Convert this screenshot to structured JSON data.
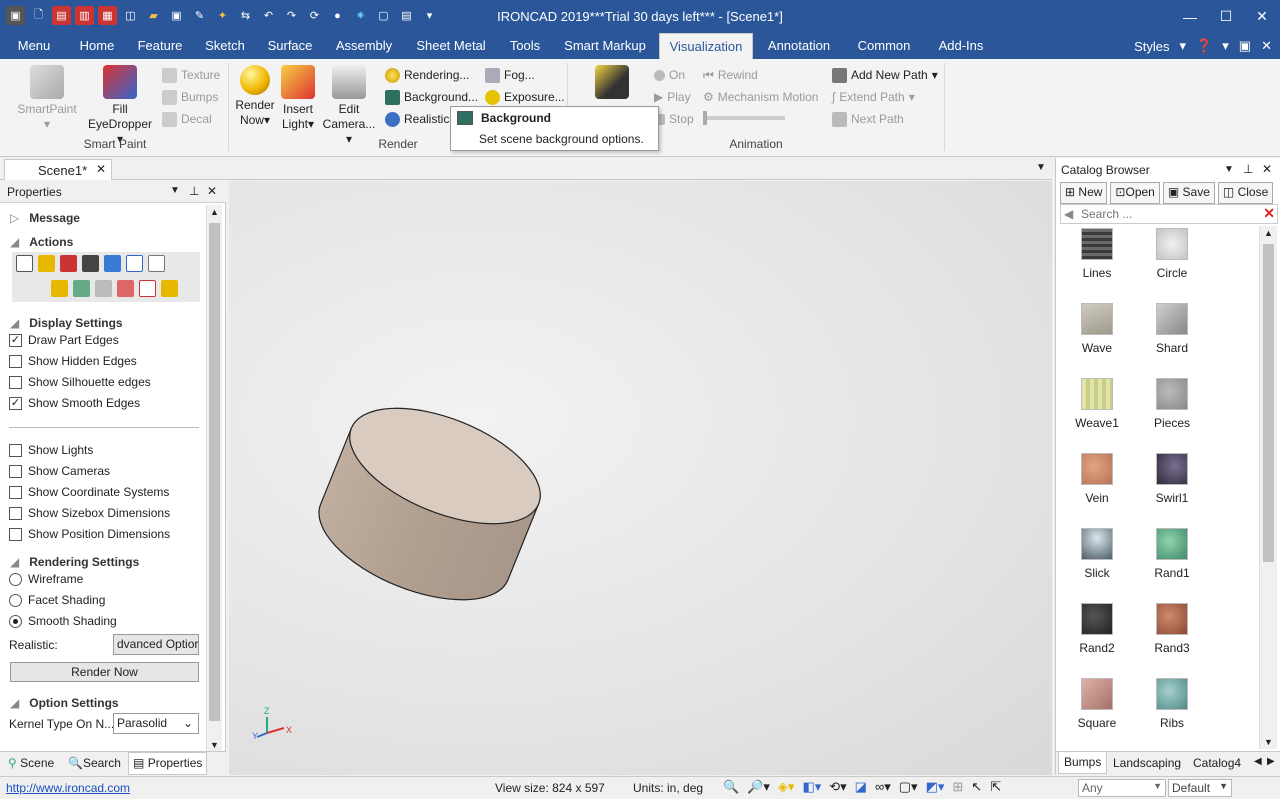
{
  "window": {
    "title": "IRONCAD 2019***Trial 30 days left*** - [Scene1*]"
  },
  "tabs": [
    "Menu",
    "Home",
    "Feature",
    "Sketch",
    "Surface",
    "Assembly",
    "Sheet Metal",
    "Tools",
    "Smart Markup",
    "Visualization",
    "Annotation",
    "Common",
    "Add-Ins"
  ],
  "active_tab": "Visualization",
  "tab_right": {
    "styles": "Styles"
  },
  "ribbon": {
    "smart_paint": {
      "smartpaint": "SmartPaint",
      "fill": "Fill",
      "eyedropper": "EyeDropper",
      "texture": "Texture",
      "bumps": "Bumps",
      "decal": "Decal",
      "group": "Smart Paint"
    },
    "render": {
      "render_now_1": "Render",
      "render_now_2": "Now",
      "insert_light_1": "Insert",
      "insert_light_2": "Light",
      "edit_camera_1": "Edit",
      "edit_camera_2": "Camera...",
      "rendering": "Rendering...",
      "background": "Background...",
      "realistic": "Realistic...",
      "fog": "Fog...",
      "exposure": "Exposure...",
      "group": "Render"
    },
    "animation": {
      "on": "On",
      "play": "Play",
      "stop": "Stop",
      "rewind": "Rewind",
      "mechanism_motion": "Mechanism Motion",
      "add_new_path": "Add New Path",
      "extend_path": "Extend Path",
      "next_path": "Next Path",
      "group": "Animation"
    }
  },
  "tooltip": {
    "title": "Background",
    "description": "Set scene background options."
  },
  "doc_tab": {
    "label": "Scene1*"
  },
  "properties": {
    "title": "Properties",
    "message": "Message",
    "actions": "Actions",
    "display_settings": "Display Settings",
    "display_options": [
      {
        "label": "Draw Part Edges",
        "checked": true
      },
      {
        "label": "Show Hidden Edges",
        "checked": false
      },
      {
        "label": "Show Silhouette edges",
        "checked": false
      },
      {
        "label": "Show Smooth Edges",
        "checked": true
      }
    ],
    "show_options": [
      {
        "label": "Show Lights",
        "checked": false
      },
      {
        "label": "Show Cameras",
        "checked": false
      },
      {
        "label": "Show Coordinate Systems",
        "checked": false
      },
      {
        "label": "Show Sizebox Dimensions",
        "checked": false
      },
      {
        "label": "Show Position Dimensions",
        "checked": false
      }
    ],
    "rendering_settings": "Rendering Settings",
    "rendering_modes": [
      {
        "label": "Wireframe",
        "selected": false
      },
      {
        "label": "Facet Shading",
        "selected": false
      },
      {
        "label": "Smooth Shading",
        "selected": true
      }
    ],
    "realistic_label": "Realistic:",
    "realistic_value": "dvanced Optior",
    "render_now_button": "Render Now",
    "option_settings": "Option Settings",
    "kernel_label": "Kernel Type On N...",
    "kernel_value": "Parasolid"
  },
  "bottom_tabs": {
    "scene": "Scene",
    "search": "Search",
    "properties": "Properties"
  },
  "triad": {
    "x": "X",
    "y": "Y",
    "z": "Z"
  },
  "catalog": {
    "title": "Catalog Browser",
    "new": "New",
    "open": "Open",
    "save": "Save",
    "close": "Close",
    "search_placeholder": "Search ...",
    "items": [
      {
        "label": "Lines",
        "color": "#4a4a4a"
      },
      {
        "label": "Circle",
        "color": "#d8d8d8"
      },
      {
        "label": "Wave",
        "color": "#b9b5a8"
      },
      {
        "label": "Shard",
        "color": "#a9a9a9"
      },
      {
        "label": "Weave1",
        "color": "#d9dca0"
      },
      {
        "label": "Pieces",
        "color": "#9c9c9c"
      },
      {
        "label": "Vein",
        "color": "#c98a6b"
      },
      {
        "label": "Swirl1",
        "color": "#4a4358"
      },
      {
        "label": "Slick",
        "color": "#7f8f98"
      },
      {
        "label": "Rand1",
        "color": "#6fb08f"
      },
      {
        "label": "Rand2",
        "color": "#3a3a3a"
      },
      {
        "label": "Rand3",
        "color": "#b06a4f"
      },
      {
        "label": "Square",
        "color": "#c4948a"
      },
      {
        "label": "Ribs",
        "color": "#7aaaa8"
      }
    ],
    "tabs": [
      "Bumps",
      "Landscaping",
      "Catalog4"
    ]
  },
  "status": {
    "url": "http://www.ironcad.com",
    "view_size": "View size:  824 x  597",
    "units": "Units: in, deg",
    "any": "Any",
    "default": "Default"
  },
  "colors": {
    "accent": "#2b579a",
    "part_top": "#d9cbbf",
    "part_side": "#b7a596"
  }
}
